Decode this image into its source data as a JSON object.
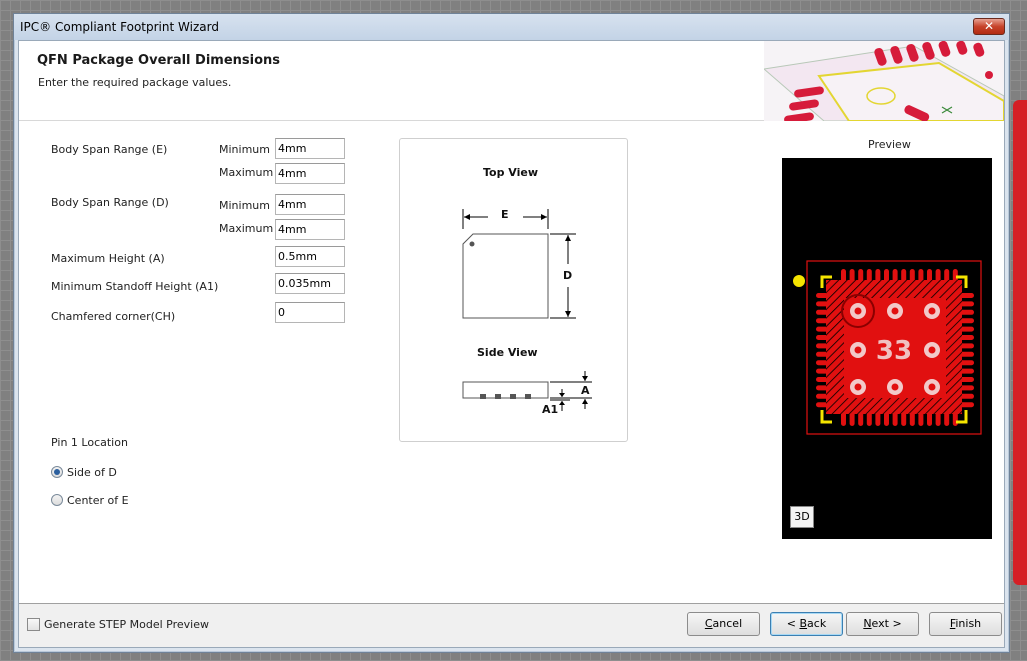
{
  "window": {
    "title": "IPC® Compliant Footprint Wizard",
    "close_glyph": "✕"
  },
  "header": {
    "title": "QFN Package Overall Dimensions",
    "subtitle": "Enter the required package values."
  },
  "fields": {
    "body_span_e": {
      "label": "Body Span Range (E)",
      "min_label": "Minimum",
      "min_value": "4mm",
      "max_label": "Maximum",
      "max_value": "4mm"
    },
    "body_span_d": {
      "label": "Body Span Range (D)",
      "min_label": "Minimum",
      "min_value": "4mm",
      "max_label": "Maximum",
      "max_value": "4mm"
    },
    "max_height": {
      "label": "Maximum Height (A)",
      "value": "0.5mm"
    },
    "min_standoff": {
      "label": "Minimum Standoff Height (A1)",
      "value": "0.035mm"
    },
    "chamfer": {
      "label": "Chamfered corner(CH)",
      "value": "0"
    }
  },
  "pin1": {
    "heading": "Pin 1 Location",
    "options": [
      {
        "label": "Side of D",
        "checked": true
      },
      {
        "label": "Center of E",
        "checked": false
      }
    ]
  },
  "diagram": {
    "top_view_title": "Top View",
    "side_view_title": "Side View",
    "label_e": "E",
    "label_d": "D",
    "label_a": "A",
    "label_a1": "A1"
  },
  "preview": {
    "label": "Preview",
    "pad_number": "33",
    "view_3d_button": "3D"
  },
  "footer": {
    "step_preview_label": "Generate STEP Model Preview",
    "step_preview_checked": false,
    "buttons": {
      "cancel": {
        "pre": "",
        "key": "C",
        "post": "ancel"
      },
      "back": {
        "pre": "< ",
        "key": "B",
        "post": "ack"
      },
      "next": {
        "pre": "",
        "key": "N",
        "post": "ext >"
      },
      "finish": {
        "pre": "",
        "key": "F",
        "post": "inish"
      }
    }
  },
  "colors": {
    "pcb_red": "#e11010",
    "pcb_yellow": "#f5e400",
    "pcb_background": "#000000"
  }
}
